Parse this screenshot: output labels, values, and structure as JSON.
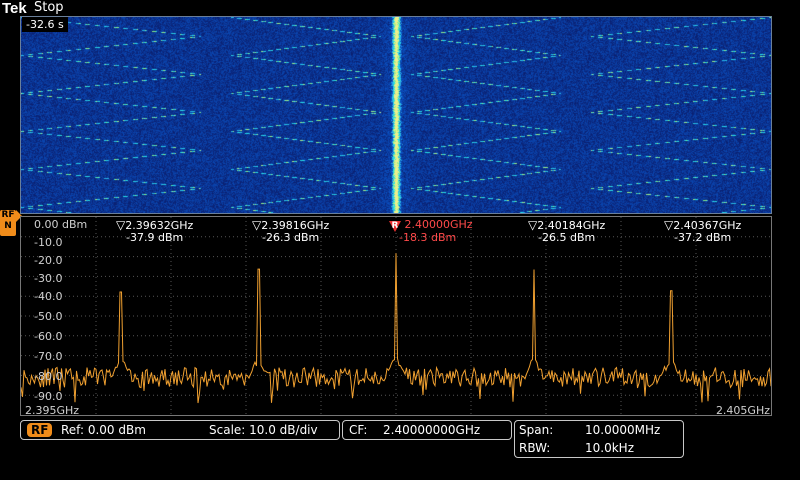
{
  "header": {
    "brand_prefix": "Tek",
    "run_state": "Stop"
  },
  "spectrogram": {
    "time_label": "-32.6 s"
  },
  "rf_marker_tag": "RF\nN",
  "spectrum": {
    "y_ticks": [
      "0.00 dBm",
      "-10.0",
      "-20.0",
      "-30.0",
      "-40.0",
      "-50.0",
      "-60.0",
      "-70.0",
      "-80.0",
      "-90.0"
    ],
    "start_freq": "2.395GHz",
    "stop_freq": "2.405GHz",
    "markers": [
      {
        "freq": "2.39632GHz",
        "ampl": "-37.9 dBm",
        "is_ref": false
      },
      {
        "freq": "2.39816GHz",
        "ampl": "-26.3 dBm",
        "is_ref": false
      },
      {
        "freq": "2.40000GHz",
        "ampl": "-18.3 dBm",
        "is_ref": true
      },
      {
        "freq": "2.40184GHz",
        "ampl": "-26.5 dBm",
        "is_ref": false
      },
      {
        "freq": "2.40367GHz",
        "ampl": "-37.2 dBm",
        "is_ref": false
      }
    ],
    "trace_color": "#f0a030",
    "grid_color": "#555555"
  },
  "readouts": {
    "rf_label": "RF",
    "ref_label": "Ref: 0.00 dBm",
    "scale_label": "Scale: 10.0 dB/div",
    "cf_label": "CF:",
    "cf_value": "2.40000000GHz",
    "span_label": "Span:",
    "span_value": "10.0000MHz",
    "rbw_label": "RBW:",
    "rbw_value": "10.0kHz"
  },
  "colors": {
    "accent_orange": "#f08c1a",
    "ref_marker_red": "#ff4a4a",
    "spectrogram_bg": "#1a3aa0"
  },
  "icons": {
    "marker_triangle": "triangle-down-icon",
    "ref_marker": "reference-marker-icon"
  }
}
